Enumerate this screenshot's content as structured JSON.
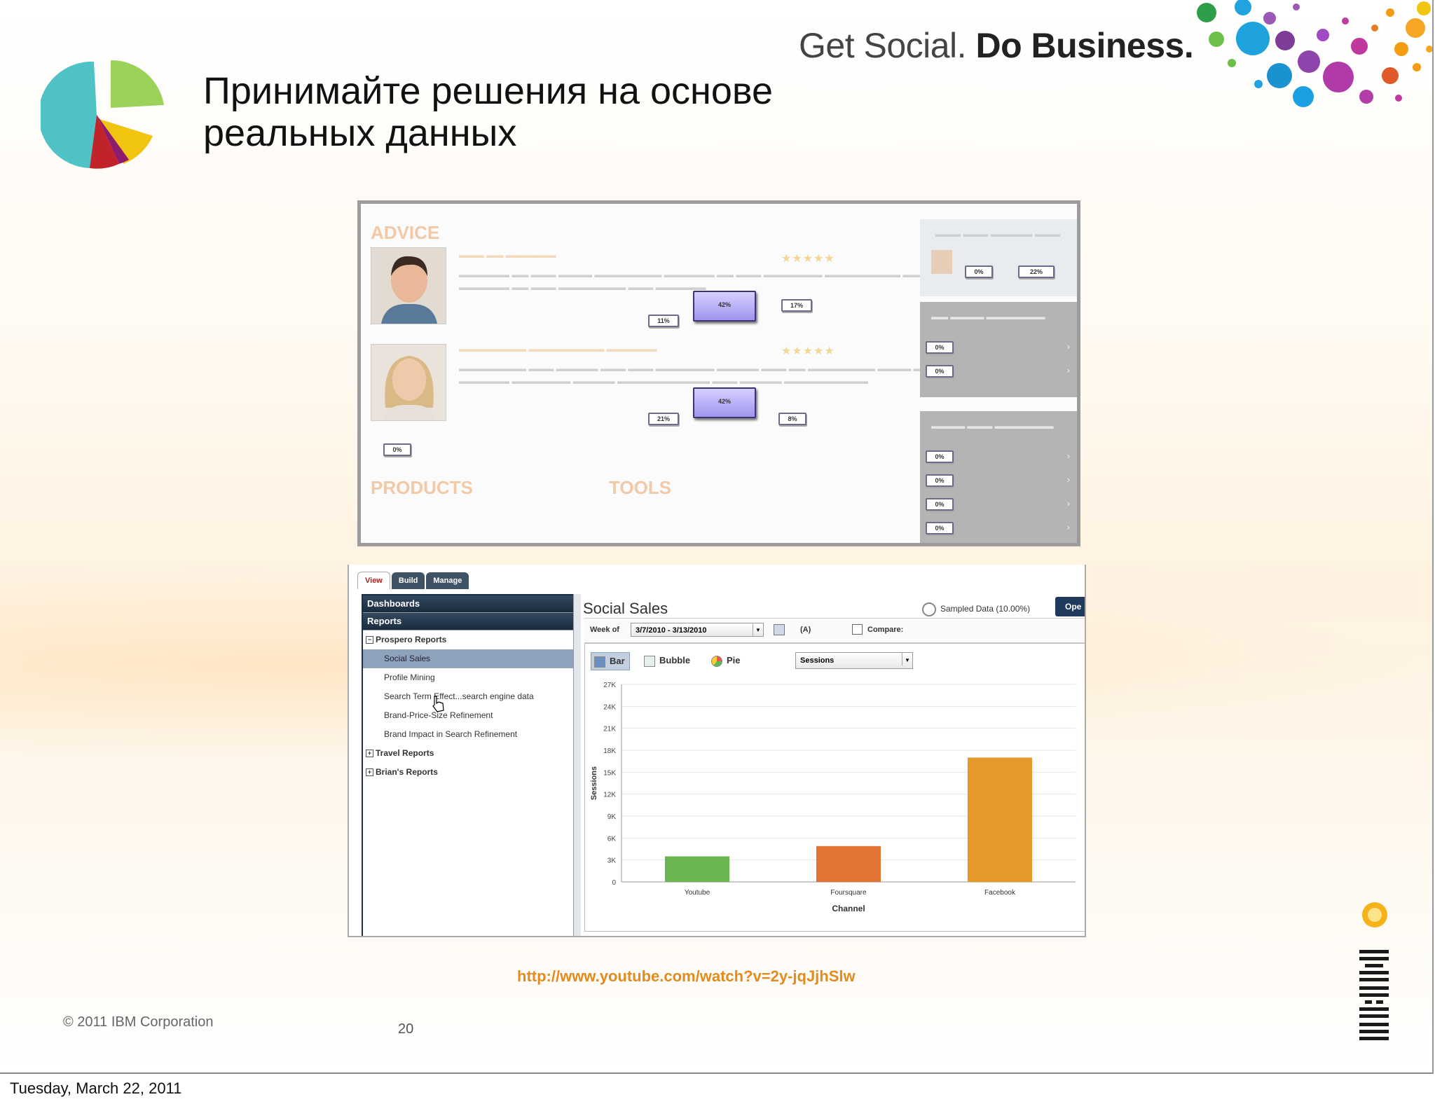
{
  "slide": {
    "tagline_light": "Get Social.",
    "tagline_bold": "Do Business.",
    "title_line1": "Принимайте решения на основе",
    "title_line2": "реальных данных",
    "url": "http://www.youtube.com/watch?v=2y-jqJjhSlw",
    "copyright": "© 2011  IBM Corporation",
    "page_number": "20",
    "date": "Tuesday, March 22, 2011"
  },
  "overlay_screenshot": {
    "sections": [
      "ADVICE",
      "PRODUCTS",
      "TOOLS"
    ],
    "overlay_percentages": [
      "42%",
      "17%",
      "11%",
      "42%",
      "21%",
      "8%",
      "0%",
      "22%"
    ],
    "sidebar_percentages": [
      "0%",
      "0%",
      "0%",
      "0%",
      "0%",
      "0%"
    ]
  },
  "analytics_app": {
    "tabs": [
      "View",
      "Build",
      "Manage"
    ],
    "nav_headers": [
      "Dashboards",
      "Reports"
    ],
    "tree": {
      "group_1": "Prospero Reports",
      "items": [
        "Social Sales",
        "Profile Mining",
        "Search Term Effect...search engine data",
        "Brand-Price-Size Refinement",
        "Brand Impact in Search Refinement"
      ],
      "group_2": "Travel Reports",
      "group_3": "Brian's Reports"
    },
    "report_title": "Social Sales",
    "sampled_label": "Sampled Data (10.00%)",
    "open_label": "Ope",
    "week_label": "Week of",
    "week_value": "3/7/2010 - 3/13/2010",
    "a_label": "(A)",
    "compare_label": "Compare:",
    "chart_types": [
      "Bar",
      "Bubble",
      "Pie"
    ],
    "metric_value": "Sessions"
  },
  "chart_data": {
    "type": "bar",
    "categories": [
      "Youtube",
      "Foursquare",
      "Facebook"
    ],
    "values": [
      3500,
      4900,
      17000
    ],
    "colors": [
      "#6bb550",
      "#e27535",
      "#e69a2c"
    ],
    "xlabel": "Channel",
    "ylabel": "Sessions",
    "ylim": [
      0,
      27000
    ],
    "yticks": [
      "0",
      "3K",
      "6K",
      "9K",
      "12K",
      "15K",
      "18K",
      "21K",
      "24K",
      "27K"
    ],
    "grid": true
  }
}
